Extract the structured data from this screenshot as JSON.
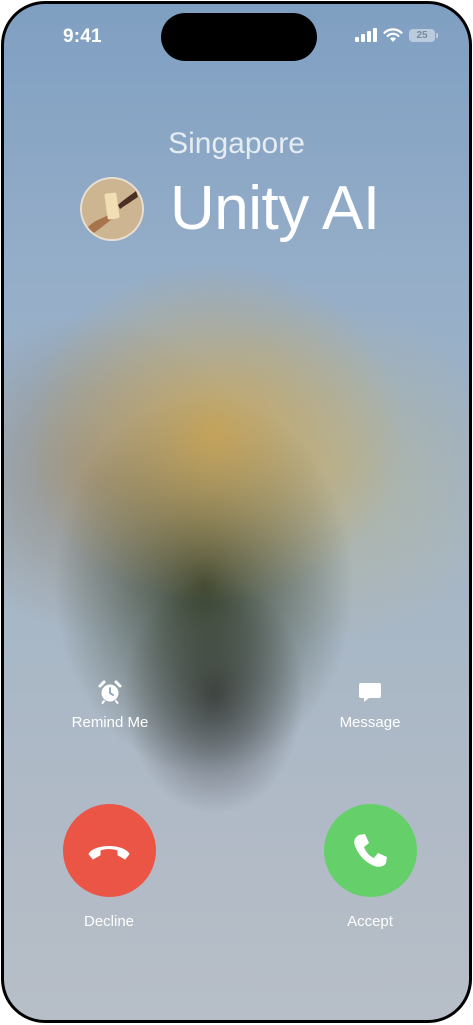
{
  "status_bar": {
    "time": "9:41",
    "battery_level": "25",
    "icons": [
      "cellular-signal-icon",
      "wifi-icon",
      "battery-icon"
    ]
  },
  "call": {
    "location": "Singapore",
    "caller_name": "Unity AI"
  },
  "actions": {
    "remind_me": {
      "label": "Remind Me",
      "icon": "alarm-clock-icon"
    },
    "message": {
      "label": "Message",
      "icon": "message-bubble-icon"
    },
    "decline": {
      "label": "Decline",
      "icon": "hang-up-icon",
      "color": "#eb5545"
    },
    "accept": {
      "label": "Accept",
      "icon": "phone-icon",
      "color": "#65cf6a"
    }
  }
}
